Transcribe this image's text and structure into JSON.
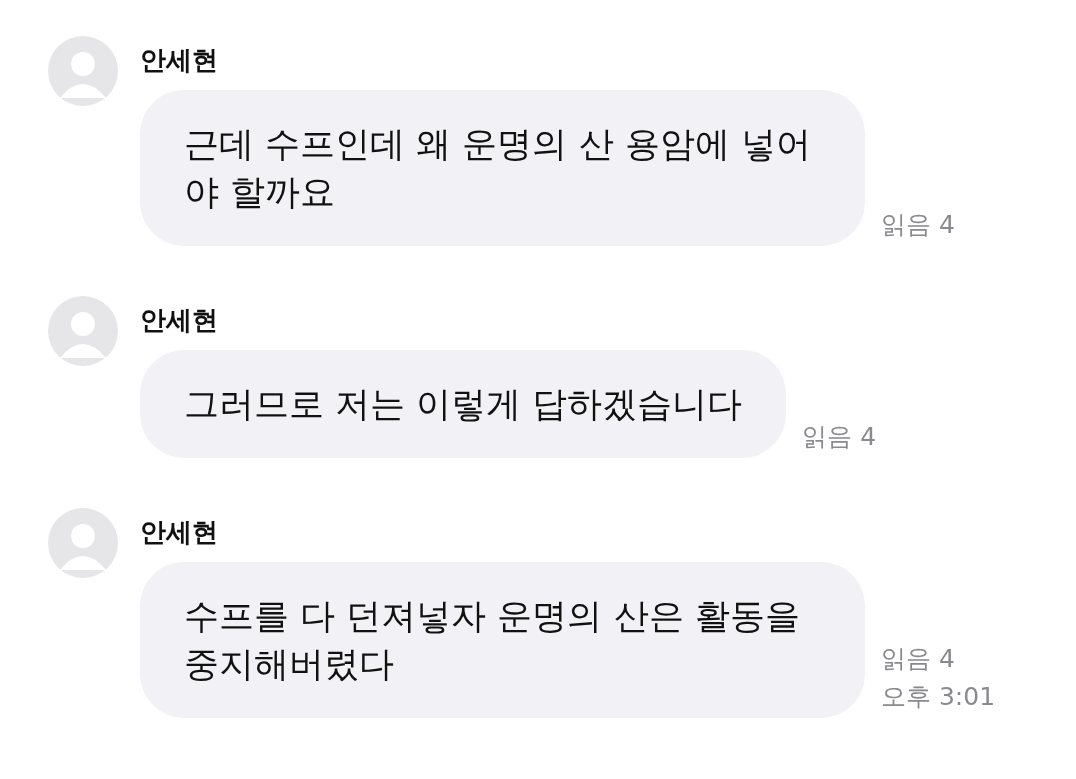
{
  "messages": [
    {
      "sender": "안세현",
      "text": "근데 수프인데 왜 운명의 산 용암에 넣어야 할까요",
      "read": "읽음 4"
    },
    {
      "sender": "안세현",
      "text": "그러므로 저는 이렇게 답하겠습니다",
      "read": "읽음 4"
    },
    {
      "sender": "안세현",
      "text": "수프를 다 던져넣자 운명의 산은 활동을 중지해버렸다",
      "read": "읽음 4",
      "time": "오후 3:01"
    }
  ]
}
